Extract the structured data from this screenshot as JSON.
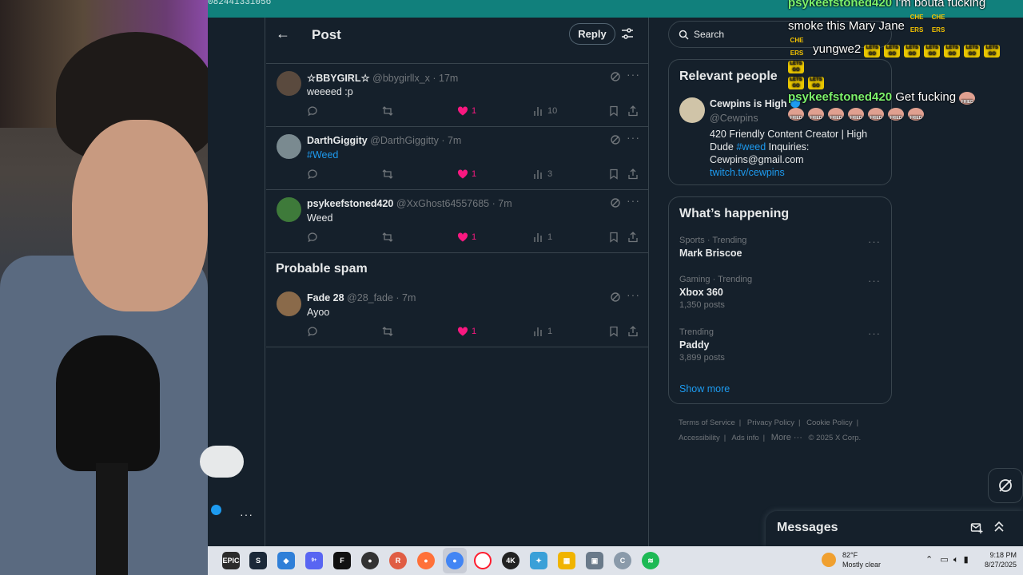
{
  "browser": {
    "url_fragment": "08244133105б"
  },
  "header": {
    "title": "Post",
    "reply_label": "Reply"
  },
  "tweets": [
    {
      "name": "☆BBYGIRL☆",
      "handle": "@bbygirllx_x",
      "time": "· 17m",
      "text": "weeeed :p",
      "is_link": false,
      "likes": "1",
      "views": "10",
      "avatar_color": "#5a4a3e"
    },
    {
      "name": "DarthGiggity",
      "handle": "@DarthGiggitty",
      "time": "· 7m",
      "text": "#Weed",
      "is_link": true,
      "likes": "1",
      "views": "3",
      "avatar_color": "#7a8a90"
    },
    {
      "name": "psykeefstoned420",
      "handle": "@XxGhost64557685",
      "time": "· 7m",
      "text": "Weed",
      "is_link": false,
      "likes": "1",
      "views": "1",
      "avatar_color": "#3e7a3a"
    }
  ],
  "spam_section": {
    "title": "Probable spam",
    "tweet": {
      "name": "Fade 28",
      "handle": "@28_fade",
      "time": "· 7m",
      "text": "Ayoo",
      "likes": "1",
      "views": "1",
      "avatar_color": "#8a6a4a"
    }
  },
  "sidebar": {
    "search_placeholder": "Search",
    "relevant": {
      "title": "Relevant people",
      "name": "Cewpins is High",
      "handle": "@Cewpins",
      "bio_part1": "420 Friendly Content Creator | High Dude ",
      "bio_hashtag": "#weed",
      "bio_part2": " Inquiries: Cewpins@gmail.com",
      "bio_link": "twitch.tv/cewpins"
    },
    "happening": {
      "title": "What’s happening",
      "trends": [
        {
          "category": "Sports · Trending",
          "name": "Mark Briscoe",
          "posts": ""
        },
        {
          "category": "Gaming · Trending",
          "name": "Xbox 360",
          "posts": "1,350 posts"
        },
        {
          "category": "Trending",
          "name": "Paddy",
          "posts": "3,899 posts"
        }
      ],
      "show_more": "Show more"
    },
    "footer": {
      "terms": "Terms of Service",
      "privacy": "Privacy Policy",
      "cookie": "Cookie Policy",
      "accessibility": "Accessibility",
      "ads": "Ads info",
      "more": "More ···",
      "copyright": "© 2025 X Corp."
    }
  },
  "messages": {
    "title": "Messages"
  },
  "chat": {
    "line1_user": "psykeefstoned420",
    "line1_text": "I'm bouta fucking smoke this Mary Jane",
    "cheers_emote": "CHE ERS",
    "line2_text": "yungwe2",
    "letsgo_emote": "LETS GO",
    "line3_user": "psykeefstoned420",
    "line3_text": "Get fucking",
    "fried_emote": "FRIED"
  },
  "taskbar": {
    "temperature": "82°F",
    "weather": "Mostly clear",
    "time": "9:18 PM",
    "date": "8/27/2025",
    "discord_badge": "9+"
  },
  "colors": {
    "accent": "#1d9bf0",
    "like": "#f91880",
    "background": "#15202b",
    "border": "#38444d",
    "muted": "#71767b",
    "chat_username": "#7cf26c"
  }
}
